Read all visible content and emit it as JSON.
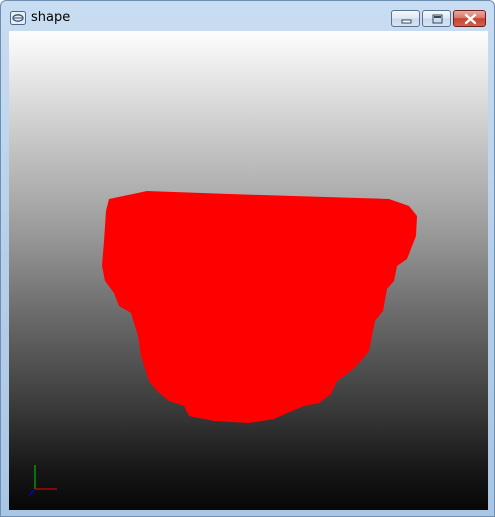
{
  "window": {
    "title": "shape",
    "icon": "app-window-icon",
    "controls": {
      "minimize": "minimize-icon",
      "maximize": "maximize-icon",
      "close": "close-icon"
    }
  },
  "scene": {
    "background_gradient": [
      "#ffffff",
      "#000000"
    ],
    "shape_color": "#ff0000",
    "axes_colors": {
      "x": "#ff0000",
      "y": "#00cc00",
      "z": "#0000ff"
    }
  }
}
